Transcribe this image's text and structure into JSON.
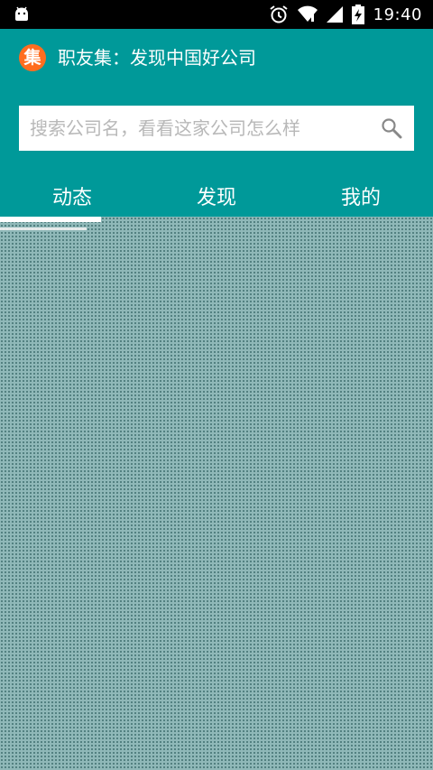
{
  "status_bar": {
    "time": "19:40",
    "icons": [
      "android-icon",
      "alarm-icon",
      "wifi-icon",
      "signal-icon",
      "battery-charging-icon"
    ]
  },
  "app": {
    "logo_text": "集",
    "title": "职友集：发现中国好公司"
  },
  "search": {
    "placeholder": "搜索公司名，看看这家公司怎么样",
    "value": ""
  },
  "tabs": [
    {
      "label": "动态",
      "selected": true
    },
    {
      "label": "发现",
      "selected": false
    },
    {
      "label": "我的",
      "selected": false
    }
  ],
  "colors": {
    "primary": "#009999",
    "logo": "#ff6d1f",
    "content_overlay": "#8fb8b8"
  }
}
